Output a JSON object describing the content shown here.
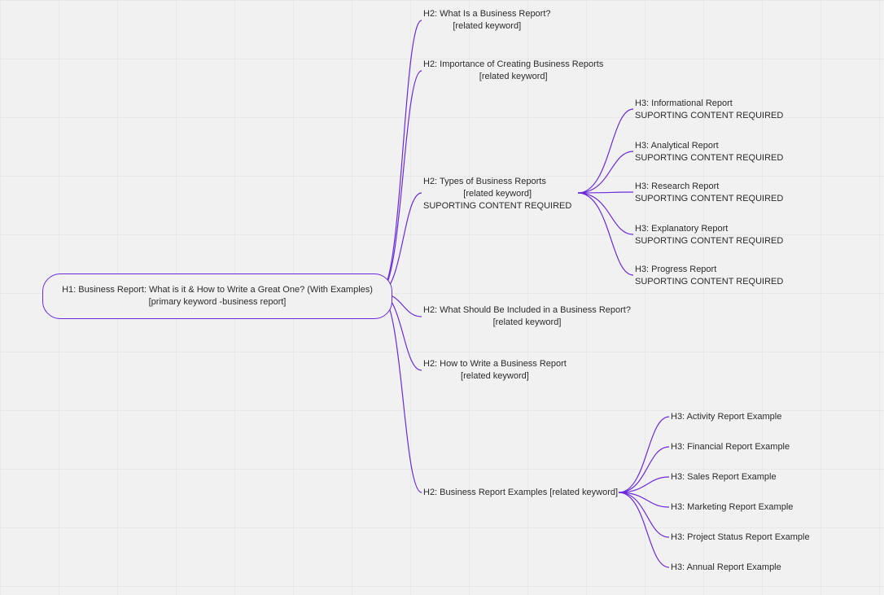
{
  "root": {
    "line1": "H1: Business Report: What is it & How to Write a Great One? (With Examples)",
    "line2": "[primary keyword -business report]"
  },
  "h2": [
    {
      "title": "H2: What Is a Business Report?",
      "sub": "[related keyword]"
    },
    {
      "title": "H2: Importance of Creating Business Reports",
      "sub": "[related keyword]"
    },
    {
      "title": "H2: Types of Business Reports",
      "sub": "[related keyword]",
      "supp": "SUPORTING CONTENT REQUIRED"
    },
    {
      "title": "H2: What Should Be Included in a Business Report?",
      "sub": "[related keyword]"
    },
    {
      "title": "H2: How to Write a Business Report",
      "sub": "[related keyword]"
    },
    {
      "title": "H2: Business Report Examples [related keyword]",
      "sub": ""
    }
  ],
  "types_h3": [
    {
      "title": "H3: Informational Report",
      "supp": "SUPORTING CONTENT REQUIRED"
    },
    {
      "title": "H3: Analytical Report",
      "supp": "SUPORTING CONTENT REQUIRED"
    },
    {
      "title": "H3: Research Report",
      "supp": "SUPORTING CONTENT REQUIRED"
    },
    {
      "title": "H3: Explanatory Report",
      "supp": "SUPORTING CONTENT REQUIRED"
    },
    {
      "title": "H3: Progress Report",
      "supp": "SUPORTING CONTENT REQUIRED"
    }
  ],
  "examples_h3": [
    {
      "title": "H3: Activity Report Example"
    },
    {
      "title": "H3: Financial Report Example"
    },
    {
      "title": "H3: Sales Report Example"
    },
    {
      "title": "H3: Marketing Report Example"
    },
    {
      "title": "H3: Project Status Report Example"
    },
    {
      "title": "H3: Annual Report Example"
    }
  ],
  "colors": {
    "accent": "#6a2bd9"
  }
}
